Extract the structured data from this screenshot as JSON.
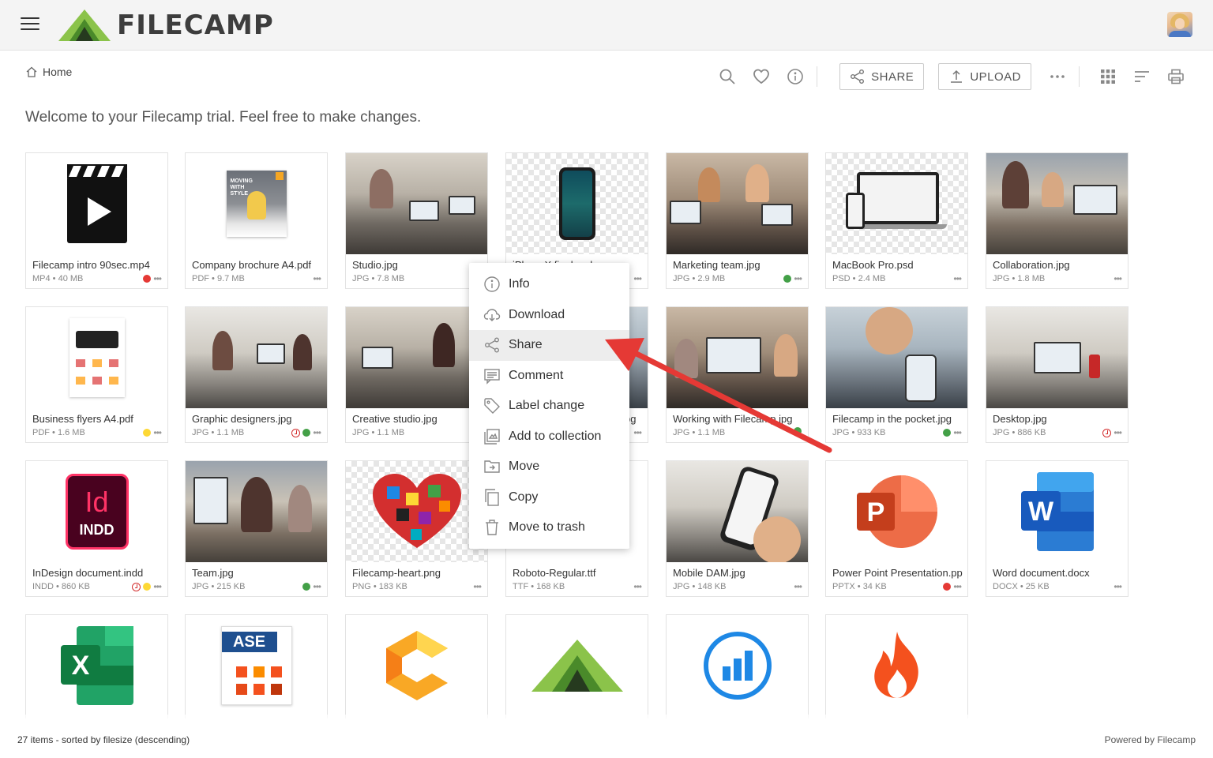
{
  "header": {
    "logo_text": "FILECAMP"
  },
  "breadcrumb": {
    "home": "Home"
  },
  "toolbar": {
    "share_label": "SHARE",
    "upload_label": "UPLOAD"
  },
  "welcome": "Welcome to your Filecamp trial. Feel free to make changes.",
  "files": [
    {
      "name": "Filecamp intro 90sec.mp4",
      "meta": "MP4 • 40 MB"
    },
    {
      "name": "Company brochure A4.pdf",
      "meta": "PDF • 9.7 MB"
    },
    {
      "name": "Studio.jpg",
      "meta": "JPG • 7.8 MB"
    },
    {
      "name": "iPhoneX final.psd",
      "meta": ""
    },
    {
      "name": "Marketing team.jpg",
      "meta": "JPG • 2.9 MB"
    },
    {
      "name": "MacBook Pro.psd",
      "meta": "PSD • 2.4 MB"
    },
    {
      "name": "Collaboration.jpg",
      "meta": "JPG • 1.8 MB"
    },
    {
      "name": "Business flyers A4.pdf",
      "meta": "PDF • 1.6 MB"
    },
    {
      "name": "Graphic designers.jpg",
      "meta": "JPG • 1.1 MB"
    },
    {
      "name": "Creative studio.jpg",
      "meta": "JPG • 1.1 MB"
    },
    {
      "name": "pg",
      "meta": ""
    },
    {
      "name": "Working with Filecamp.jpg",
      "meta": "JPG • 1.1 MB"
    },
    {
      "name": "Filecamp in the pocket.jpg",
      "meta": "JPG • 933 KB"
    },
    {
      "name": "Desktop.jpg",
      "meta": "JPG • 886 KB"
    },
    {
      "name": "InDesign document.indd",
      "meta": "INDD • 860 KB"
    },
    {
      "name": "Team.jpg",
      "meta": "JPG • 215 KB"
    },
    {
      "name": "Filecamp-heart.png",
      "meta": "PNG • 183 KB"
    },
    {
      "name": "Roboto-Regular.ttf",
      "meta": "TTF • 168 KB"
    },
    {
      "name": "Mobile DAM.jpg",
      "meta": "JPG • 148 KB"
    },
    {
      "name": "Power Point Presentation.pptx",
      "meta": "PPTX • 34 KB"
    },
    {
      "name": "Word document.docx",
      "meta": "DOCX • 25 KB"
    }
  ],
  "thumb_text": {
    "indd_id": "Id",
    "indd_ext": "INDD",
    "ase": "ASE",
    "brochure": "MOVING WITH STYLE"
  },
  "context_menu": [
    {
      "label": "Info",
      "icon": "info-icon"
    },
    {
      "label": "Download",
      "icon": "cloud-download-icon"
    },
    {
      "label": "Share",
      "icon": "share-icon"
    },
    {
      "label": "Comment",
      "icon": "comment-icon"
    },
    {
      "label": "Label change",
      "icon": "tag-icon"
    },
    {
      "label": "Add to collection",
      "icon": "collection-icon"
    },
    {
      "label": "Move",
      "icon": "folder-move-icon"
    },
    {
      "label": "Copy",
      "icon": "copy-icon"
    },
    {
      "label": "Move to trash",
      "icon": "trash-icon"
    }
  ],
  "footer": {
    "summary": "27 items - sorted by filesize (descending)",
    "powered": "Powered by Filecamp"
  },
  "colors": {
    "brand_green": "#7cb342",
    "arrow_red": "#e53935"
  }
}
